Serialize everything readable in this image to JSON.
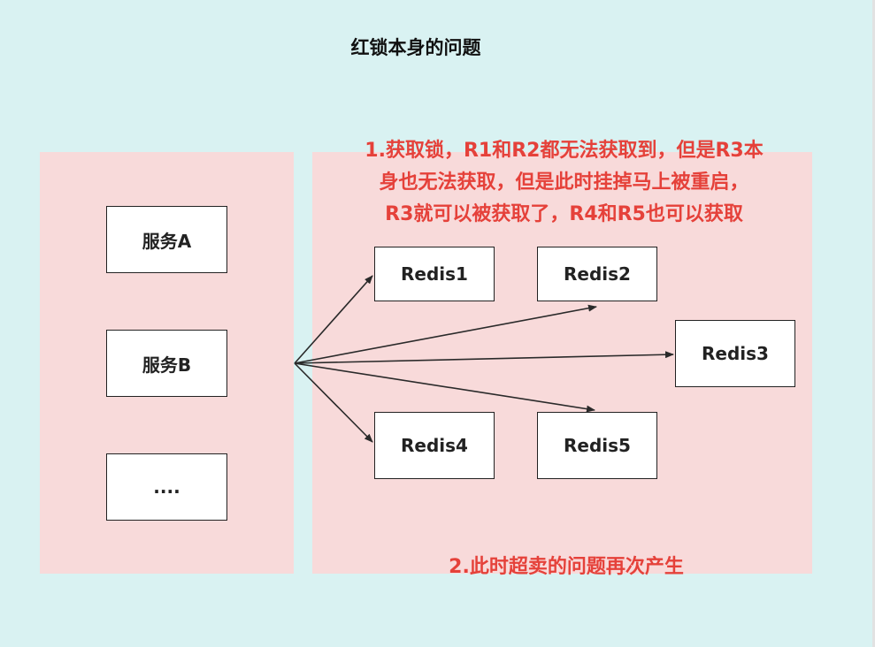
{
  "diagram": {
    "title": "红锁本身的问题",
    "services": [
      "服务A",
      "服务B",
      "...."
    ],
    "redis_nodes": [
      "Redis1",
      "Redis2",
      "Redis3",
      "Redis4",
      "Redis5"
    ],
    "note_1": [
      "1.获取锁，R1和R2都无法获取到，但是R3本",
      "身也无法获取，但是此时挂掉马上被重启，",
      "R3就可以被获取了，R4和R5也可以获取"
    ],
    "note_2": "2.此时超卖的问题再次产生",
    "colors": {
      "background": "#d9f2f2",
      "panel": "#f8dada",
      "note_text": "#e5413a",
      "box_border": "#222222"
    }
  }
}
